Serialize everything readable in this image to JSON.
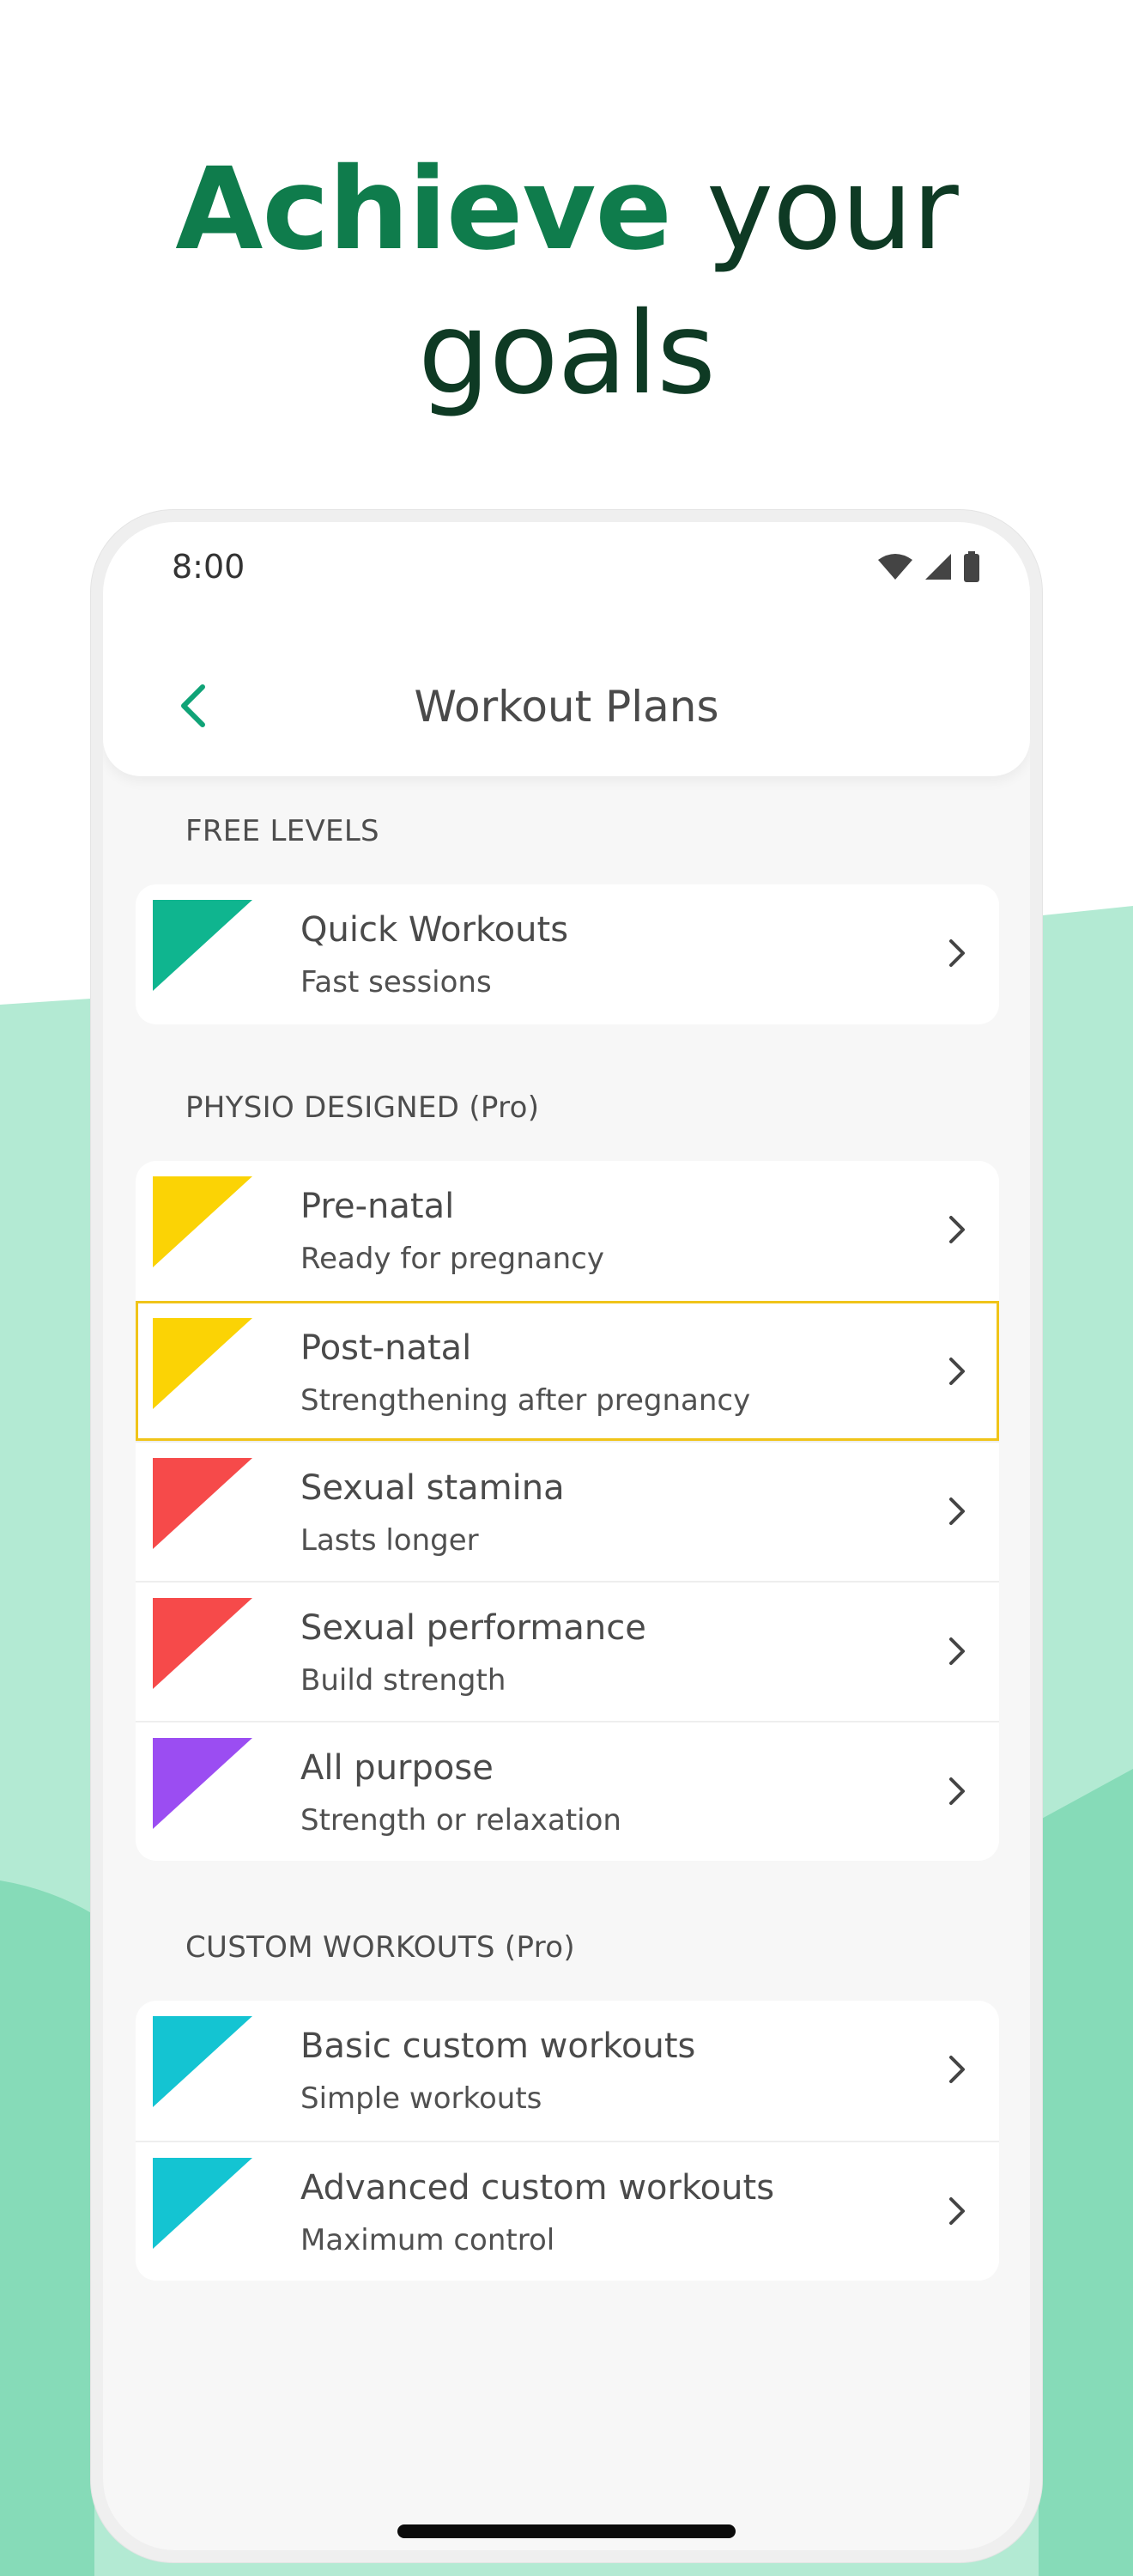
{
  "headline": {
    "accent": "Achieve",
    "rest_line1": "your",
    "rest_line2": "goals"
  },
  "colors": {
    "headline_accent": "#0f7c4c",
    "headline_dark": "#0e3a24",
    "back_arrow": "#10a377",
    "wave_light": "#a8e6cc",
    "wave_mid": "#86dbb8",
    "selected_outline": "#f0c419"
  },
  "status_bar": {
    "time": "8:00",
    "icons": [
      "wifi-icon",
      "signal-icon",
      "battery-icon"
    ]
  },
  "app_bar": {
    "back_icon": "chevron-left-icon",
    "title": "Workout Plans"
  },
  "sections": [
    {
      "header": "FREE LEVELS",
      "items": [
        {
          "title": "Quick Workouts",
          "subtitle": "Fast sessions",
          "color": "#0fb58f",
          "selected": false
        }
      ]
    },
    {
      "header": "PHYSIO DESIGNED (Pro)",
      "items": [
        {
          "title": "Pre-natal",
          "subtitle": "Ready for pregnancy",
          "color": "#fbd305",
          "selected": false
        },
        {
          "title": "Post-natal",
          "subtitle": "Strengthening after pregnancy",
          "color": "#fbd305",
          "selected": true
        },
        {
          "title": "Sexual stamina",
          "subtitle": "Lasts longer",
          "color": "#f64a4a",
          "selected": false
        },
        {
          "title": "Sexual performance",
          "subtitle": "Build strength",
          "color": "#f64a4a",
          "selected": false
        },
        {
          "title": "All purpose",
          "subtitle": "Strength or relaxation",
          "color": "#9b4df2",
          "selected": false
        }
      ]
    },
    {
      "header": "CUSTOM WORKOUTS (Pro)",
      "items": [
        {
          "title": "Basic custom workouts",
          "subtitle": "Simple workouts",
          "color": "#14c4d2",
          "selected": false
        },
        {
          "title": "Advanced custom workouts",
          "subtitle": "Maximum control",
          "color": "#14c4d2",
          "selected": false
        }
      ]
    }
  ]
}
